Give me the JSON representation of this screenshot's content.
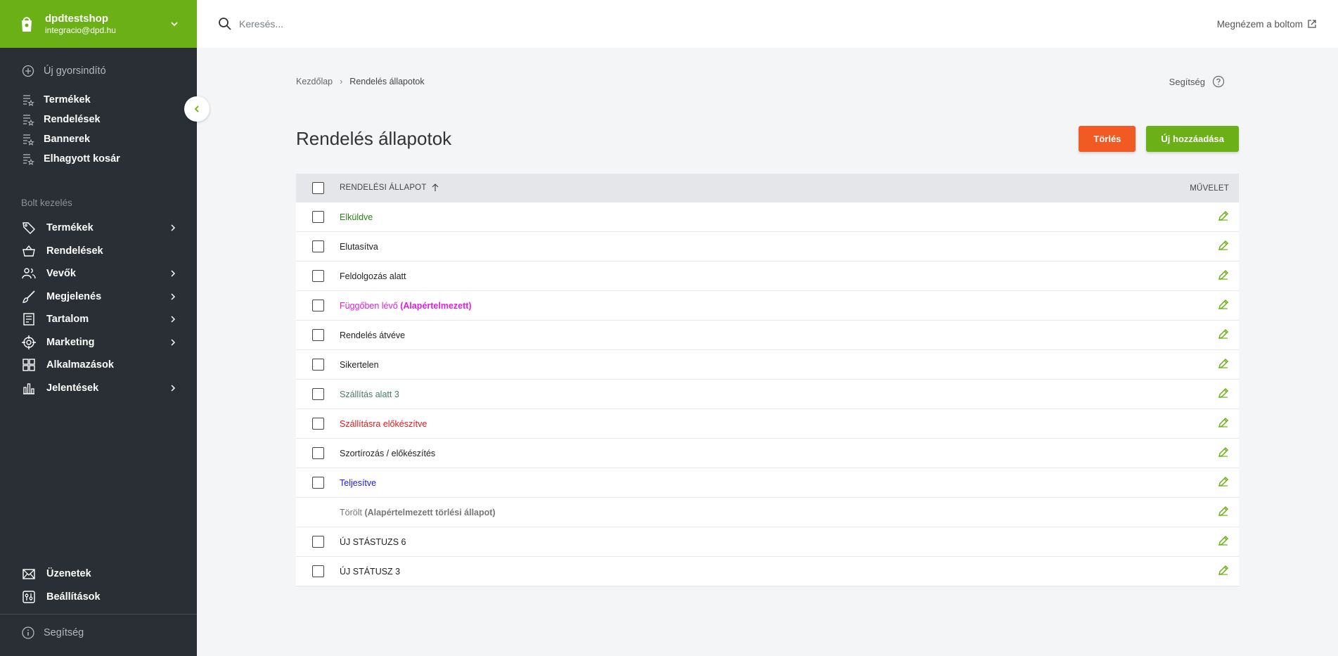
{
  "shop": {
    "name": "dpdtestshop",
    "email": "integracio@dpd.hu"
  },
  "quick_menu": {
    "new_quick": "Új gyorsindító",
    "items": [
      "Termékek",
      "Rendelések",
      "Bannerek",
      "Elhagyott kosár"
    ]
  },
  "store_section": {
    "title": "Bolt kezelés",
    "items": [
      {
        "label": "Termékek",
        "icon": "tag-icon",
        "has_children": true
      },
      {
        "label": "Rendelések",
        "icon": "basket-icon",
        "has_children": false
      },
      {
        "label": "Vevők",
        "icon": "users-icon",
        "has_children": true
      },
      {
        "label": "Megjelenés",
        "icon": "brush-icon",
        "has_children": true
      },
      {
        "label": "Tartalom",
        "icon": "document-icon",
        "has_children": true
      },
      {
        "label": "Marketing",
        "icon": "target-icon",
        "has_children": true
      },
      {
        "label": "Alkalmazások",
        "icon": "apps-icon",
        "has_children": false
      },
      {
        "label": "Jelentések",
        "icon": "chart-icon",
        "has_children": true
      }
    ]
  },
  "bottom_menu": {
    "messages": "Üzenetek",
    "settings": "Beállítások",
    "help": "Segítség"
  },
  "topbar": {
    "search_placeholder": "Keresés...",
    "view_shop": "Megnézem a boltom"
  },
  "breadcrumb": {
    "home": "Kezdőlap",
    "current": "Rendelés állapotok"
  },
  "help_label": "Segítség",
  "page": {
    "title": "Rendelés állapotok",
    "delete_btn": "Törlés",
    "add_btn": "Új hozzáadása"
  },
  "table": {
    "col_status": "RENDELÉSI ÁLLAPOT",
    "col_action": "MŰVELET",
    "rows": [
      {
        "name": "Elküldve",
        "color": "#2e7d1a",
        "checkbox": true,
        "extra": ""
      },
      {
        "name": "Elutasítva",
        "color": "#222222",
        "checkbox": true,
        "extra": ""
      },
      {
        "name": "Feldolgozás alatt",
        "color": "#222222",
        "checkbox": true,
        "extra": ""
      },
      {
        "name": "Függőben lévő",
        "color": "#e020e0",
        "checkbox": true,
        "extra": "(Alapértelmezett)"
      },
      {
        "name": "Rendelés átvéve",
        "color": "#222222",
        "checkbox": true,
        "extra": ""
      },
      {
        "name": "Sikertelen",
        "color": "#222222",
        "checkbox": true,
        "extra": ""
      },
      {
        "name": "Szállítás alatt 3",
        "color": "#4a7a6a",
        "checkbox": true,
        "extra": ""
      },
      {
        "name": "Szállításra előkészítve",
        "color": "#e01a1a",
        "checkbox": true,
        "extra": ""
      },
      {
        "name": "Szortírozás / előkészítés",
        "color": "#222222",
        "checkbox": true,
        "extra": ""
      },
      {
        "name": "Teljesítve",
        "color": "#1a1ae0",
        "checkbox": true,
        "extra": ""
      },
      {
        "name": "Törölt",
        "color": "#777777",
        "checkbox": false,
        "extra": "(Alapértelmezett törlési állapot)"
      },
      {
        "name": "ÚJ STÁSTUZS 6",
        "color": "#222222",
        "checkbox": true,
        "extra": ""
      },
      {
        "name": "ÚJ STÁTUSZ 3",
        "color": "#222222",
        "checkbox": true,
        "extra": ""
      }
    ]
  },
  "colors": {
    "brand_green": "#6ab016",
    "sidebar_bg": "#2a2f36",
    "delete_orange": "#f15a22"
  }
}
